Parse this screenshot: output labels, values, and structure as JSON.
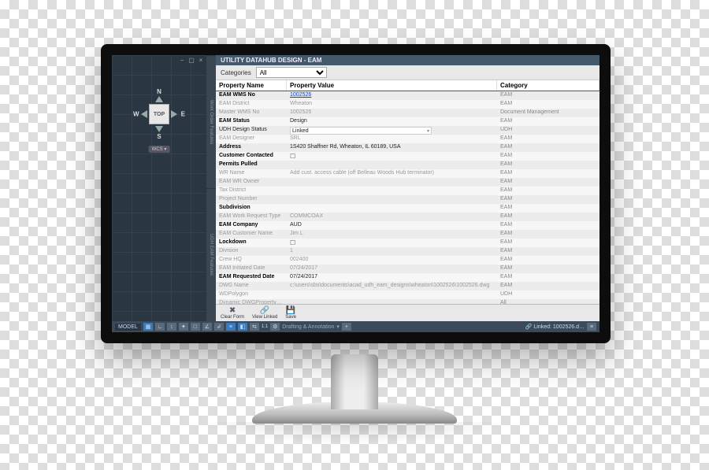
{
  "panel": {
    "title": "UTILITY DATAHUB DESIGN - EAM",
    "categories_label": "Categories",
    "categories_value": "All",
    "columns": {
      "name": "Property Name",
      "value": "Property Value",
      "category": "Category"
    }
  },
  "view_cube": {
    "face": "TOP",
    "n": "N",
    "s": "S",
    "e": "E",
    "w": "W",
    "wcs": "WCS ▾"
  },
  "side_tabs": [
    "Work Order Features",
    "UDH EAM Features"
  ],
  "rows": [
    {
      "name": "EAM WMS No",
      "value": "1002526",
      "cat": "EAM",
      "bold": true,
      "link": true
    },
    {
      "name": "EAM District",
      "value": "Wheaton",
      "cat": "EAM",
      "muted": true
    },
    {
      "name": "Master WMS No",
      "value": "1002526",
      "cat": "Document Management",
      "muted": true
    },
    {
      "name": "EAM Status",
      "value": "Design",
      "cat": "EAM",
      "bold": true
    },
    {
      "name": "UDH Design Status",
      "value": "Linked",
      "cat": "UDH",
      "dropdown": true
    },
    {
      "name": "EAM Designer",
      "value": "SRL",
      "cat": "EAM",
      "muted": true
    },
    {
      "name": "Address",
      "value": "1S420 Shaffner Rd, Wheaton, IL 60189, USA",
      "cat": "EAM",
      "bold": true
    },
    {
      "name": "Customer Contacted",
      "value": "",
      "cat": "EAM",
      "bold": true,
      "checkbox": true
    },
    {
      "name": "Permits Pulled",
      "value": "",
      "cat": "EAM",
      "bold": true
    },
    {
      "name": "WR Name",
      "value": "Add cust. access cable (off Belleau Woods Hub terminator)",
      "cat": "EAM",
      "muted": true,
      "placeholder": true
    },
    {
      "name": "EAM WR Owner",
      "value": "",
      "cat": "EAM",
      "muted": true
    },
    {
      "name": "Tax District",
      "value": "",
      "cat": "EAM",
      "muted": true
    },
    {
      "name": "Project Number",
      "value": "",
      "cat": "EAM",
      "muted": true
    },
    {
      "name": "Subdivision",
      "value": "",
      "cat": "EAM",
      "bold": true
    },
    {
      "name": "EAM Work Request Type",
      "value": "COMMCOAX",
      "cat": "EAM",
      "muted": true
    },
    {
      "name": "EAM Company",
      "value": "AUD",
      "cat": "EAM",
      "bold": true
    },
    {
      "name": "EAM Customer Name",
      "value": "Jim L",
      "cat": "EAM",
      "muted": true
    },
    {
      "name": "Lockdown",
      "value": "",
      "cat": "EAM",
      "bold": true,
      "checkbox": true
    },
    {
      "name": "Division",
      "value": "1",
      "cat": "EAM",
      "muted": true
    },
    {
      "name": "Crew HQ",
      "value": "002400",
      "cat": "EAM",
      "muted": true
    },
    {
      "name": "EAM Initiated Date",
      "value": "07/24/2017",
      "cat": "EAM",
      "muted": true
    },
    {
      "name": "EAM Requested Date",
      "value": "07/24/2017",
      "cat": "EAM",
      "bold": true
    },
    {
      "name": "DWG Name",
      "value": "c:\\users\\sbs\\documents\\acad_udh_eam_designs\\wheaton\\1002526\\1002526.dwg",
      "cat": "EAM",
      "muted": true
    },
    {
      "name": "WDPolygon",
      "value": "",
      "cat": "UDH",
      "muted": true
    },
    {
      "name": "Dynamic DWGPropertyExpression",
      "value": "",
      "cat": "All",
      "muted": true
    }
  ],
  "footer": {
    "clear": "Clear Form",
    "view_linked": "View Linked",
    "save": "Save"
  },
  "status": {
    "model": "MODEL",
    "annotation": "Drafting & Annotation",
    "linked": "Linked: 1002526.d…"
  }
}
